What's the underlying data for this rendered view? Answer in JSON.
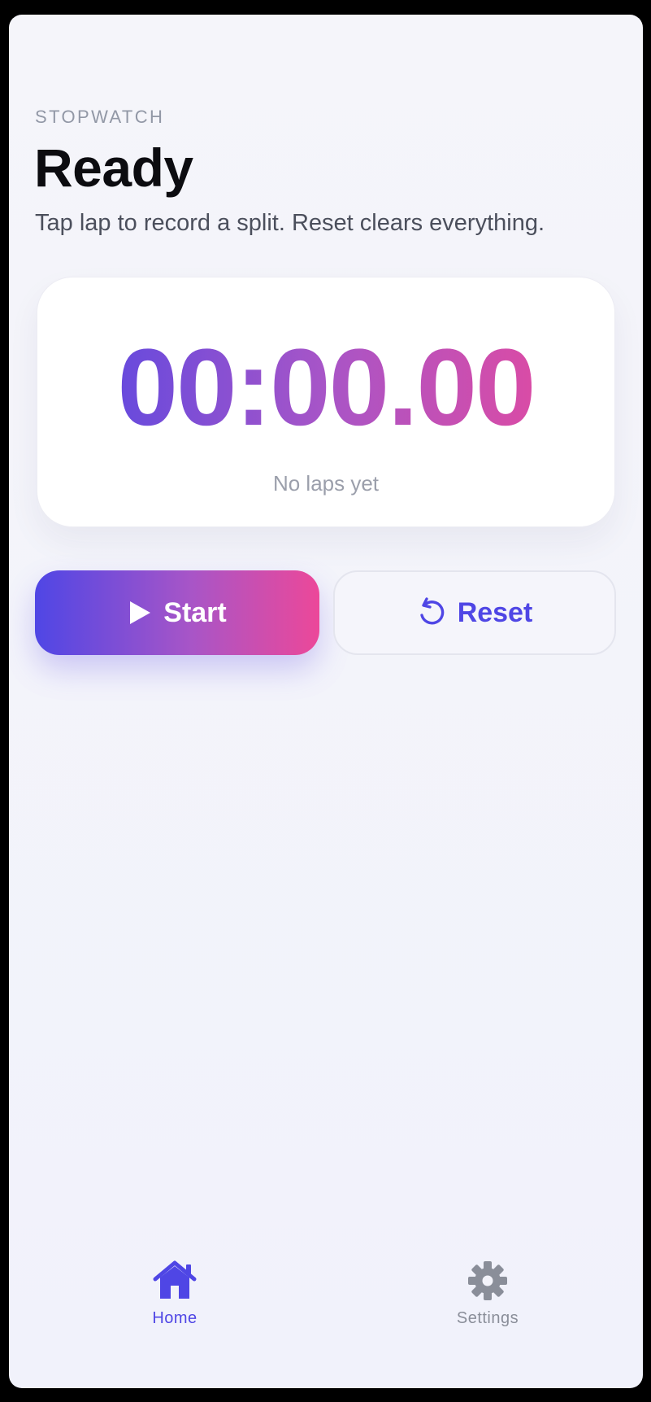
{
  "header": {
    "eyebrow": "STOPWATCH",
    "title": "Ready",
    "subtitle": "Tap lap to record a split. Reset clears everything."
  },
  "timer": {
    "display": "00:00.00",
    "laps_empty": "No laps yet"
  },
  "actions": {
    "start_label": "Start",
    "reset_label": "Reset"
  },
  "tabbar": {
    "items": [
      {
        "label": "Home",
        "icon": "home-icon",
        "active": true
      },
      {
        "label": "Settings",
        "icon": "gear-icon",
        "active": false
      }
    ]
  },
  "colors": {
    "accent": "#4f46e5",
    "gradient_start": "#4f46e5",
    "gradient_end": "#ec4899"
  }
}
